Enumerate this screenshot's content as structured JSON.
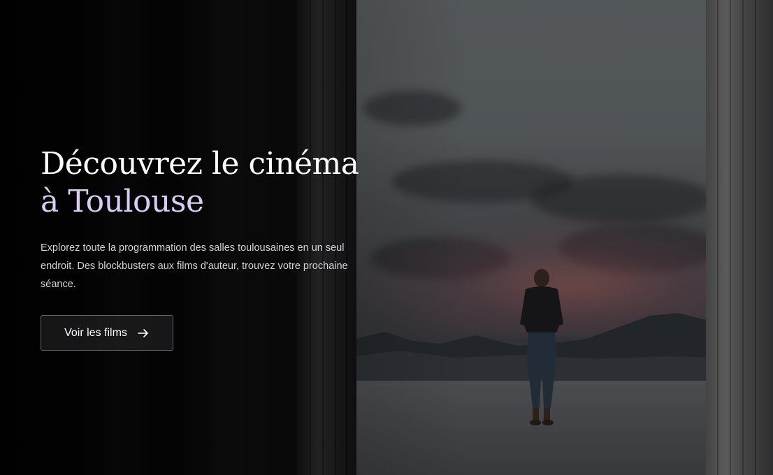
{
  "hero": {
    "title_line1": "Découvrez le cinéma",
    "title_line2": "à Toulouse",
    "description": "Explorez toute la programmation des salles toulousaines en un seul endroit. Des blockbusters aux films d'auteur, trouvez votre prochaine séance.",
    "cta_label": "Voir les films",
    "cta_icon": "arrow-right-icon",
    "accent_color": "#d9cdf4"
  }
}
